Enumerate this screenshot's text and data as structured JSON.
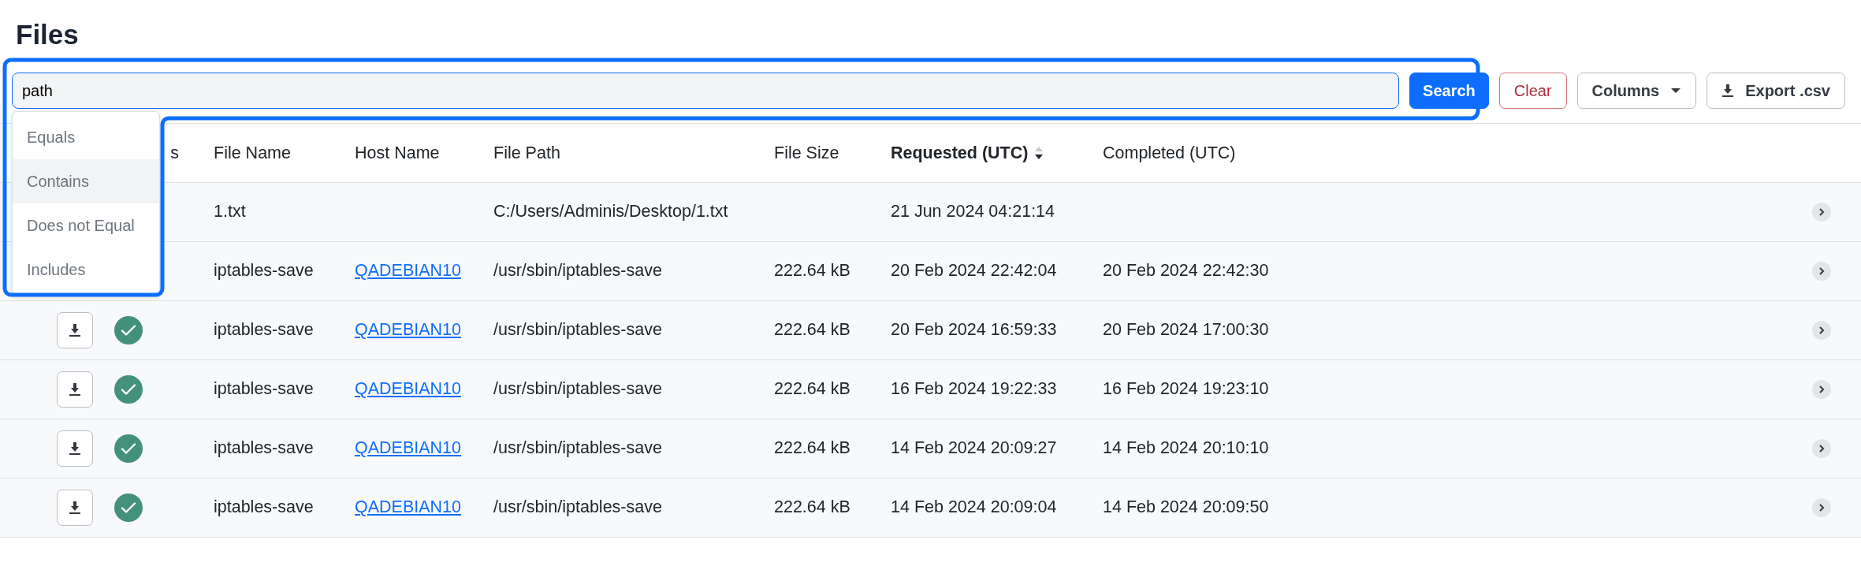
{
  "title": "Files",
  "search": {
    "value": "path",
    "button": "Search",
    "focused": true
  },
  "operator_menu": [
    {
      "label": "Equals",
      "selected": false
    },
    {
      "label": "Contains",
      "selected": true
    },
    {
      "label": "Does not Equal",
      "selected": false
    },
    {
      "label": "Includes",
      "selected": false
    }
  ],
  "actions": [
    {
      "label": "Clear",
      "kind": "danger"
    },
    {
      "label": "Columns",
      "kind": "dropdown"
    },
    {
      "label": "Export .csv",
      "kind": "export"
    }
  ],
  "table": {
    "columns": [
      {
        "label": "s",
        "sorted": false
      },
      {
        "label": "File Name",
        "sorted": false
      },
      {
        "label": "Host Name",
        "sorted": false
      },
      {
        "label": "File Path",
        "sorted": false
      },
      {
        "label": "File Size",
        "sorted": false
      },
      {
        "label": "Requested (UTC)",
        "sorted": true
      },
      {
        "label": "Completed (UTC)",
        "sorted": false
      }
    ],
    "rows": [
      {
        "file_name": "1.txt",
        "file_path": "C:/Users/Adminis/Desktop/1.txt",
        "requested": "21 Jun 2024 04:21:14"
      },
      {
        "file_name": "iptables-save",
        "host_name": "QADEBIAN10",
        "file_path": "/usr/sbin/iptables-save",
        "file_size": "222.64 kB",
        "requested": "20 Feb 2024 22:42:04",
        "completed": "20 Feb 2024 22:42:30"
      },
      {
        "downloadable": true,
        "completed_ok": true,
        "file_name": "iptables-save",
        "host_name": "QADEBIAN10",
        "file_path": "/usr/sbin/iptables-save",
        "file_size": "222.64 kB",
        "requested": "20 Feb 2024 16:59:33",
        "completed": "20 Feb 2024 17:00:30"
      },
      {
        "downloadable": true,
        "completed_ok": true,
        "file_name": "iptables-save",
        "host_name": "QADEBIAN10",
        "file_path": "/usr/sbin/iptables-save",
        "file_size": "222.64 kB",
        "requested": "16 Feb 2024 19:22:33",
        "completed": "16 Feb 2024 19:23:10"
      },
      {
        "downloadable": true,
        "completed_ok": true,
        "file_name": "iptables-save",
        "host_name": "QADEBIAN10",
        "file_path": "/usr/sbin/iptables-save",
        "file_size": "222.64 kB",
        "requested": "14 Feb 2024 20:09:27",
        "completed": "14 Feb 2024 20:10:10"
      },
      {
        "downloadable": true,
        "completed_ok": true,
        "file_name": "iptables-save",
        "host_name": "QADEBIAN10",
        "file_path": "/usr/sbin/iptables-save",
        "file_size": "222.64 kB",
        "requested": "14 Feb 2024 20:09:04",
        "completed": "14 Feb 2024 20:09:50"
      }
    ]
  }
}
